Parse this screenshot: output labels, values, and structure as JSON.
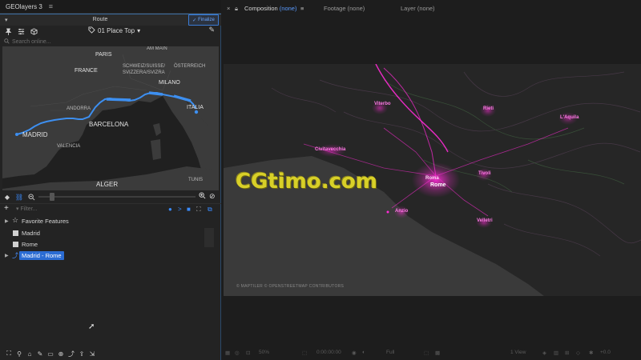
{
  "left_panel": {
    "app_title": "GEOlayers 3",
    "menu_icon": "hamburger-icon",
    "route_title": "Route",
    "finalize_label": "Finalize",
    "place_name": "01 Place Top",
    "search_placeholder": "Search online...",
    "filter_placeholder": "Filter...",
    "map_labels": {
      "am_main": "AM MAIN",
      "paris": "PARIS",
      "france": "FRANCE",
      "schweiz": "SCHWEIZ/SUISSE/",
      "svizzera": "SVIZZERA/SVIZRA",
      "osterreich": "ÖSTERREICH",
      "milano": "MILANO",
      "andorra": "ANDORRA",
      "italia": "ITALIA",
      "barcelona": "BARCELONA",
      "madrid": "MADRID",
      "valencia": "VALENCIA",
      "alger": "ALGER",
      "tunis": "TUNIS"
    },
    "tree": [
      {
        "label": "Favorite Features",
        "type": "folder"
      },
      {
        "label": "Madrid",
        "type": "feature"
      },
      {
        "label": "Rome",
        "type": "feature"
      },
      {
        "label": "Madrid - Rome",
        "type": "route",
        "selected": true
      }
    ]
  },
  "right_panel": {
    "tabs": {
      "composition_label": "Composition",
      "composition_value": "(none)",
      "footage_label": "Footage",
      "footage_value": "(none)",
      "layer_label": "Layer",
      "layer_value": "(none)"
    },
    "watermark": "CGtimo.com",
    "copyright": "© MAPTILER © OPENSTREETMAP CONTRIBUTORS",
    "city_labels": {
      "rome": "Rome",
      "viterbo": "Viterbo",
      "rieti": "Rieti",
      "laquila": "L'Aquila",
      "civitavecchia": "Civitavecchia",
      "tivoli": "Tivoli",
      "anzio": "Anzio",
      "velletri": "Velletri",
      "roma_hl": "Roma"
    },
    "status": {
      "zoom": "50%",
      "timecode": "0:00:00:00",
      "quality": "Full",
      "views": "1 View",
      "exposure": "+0.0"
    }
  },
  "colors": {
    "accent": "#2b6cd3",
    "route": "#3d8ff0",
    "magenta": "#ff2bd6",
    "watermark": "#d8d028"
  }
}
